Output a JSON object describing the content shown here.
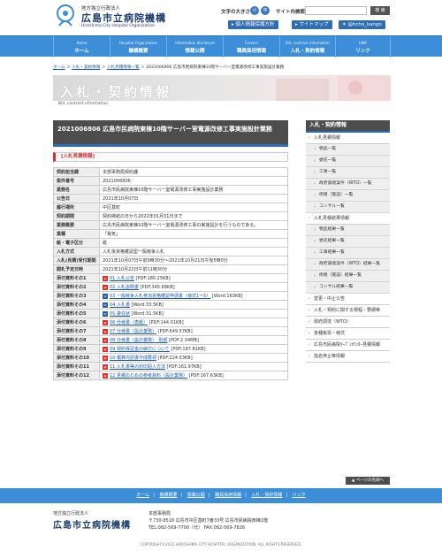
{
  "header": {
    "org_small": "地方独立行政法人",
    "logo_main": "広島市立病院機構",
    "logo_en": "Hiroshima City Hospital Organization",
    "font_size_label": "文字の大きさ",
    "font_small": "小",
    "font_medium": "中",
    "font_large": "大",
    "search_label": "サイト内検索",
    "search_placeholder": "",
    "search_button": "検 索",
    "btn_privacy": "個人情報保護方針",
    "btn_sitemap": "サイトマップ",
    "btn_twitter": "@hcho_kango"
  },
  "gnav": [
    {
      "en": "Home",
      "ja": "ホーム"
    },
    {
      "en": "Hospital Organization",
      "ja": "機構概要"
    },
    {
      "en": "Information disclosure",
      "ja": "情報公開"
    },
    {
      "en": "Careers",
      "ja": "職員採用情報"
    },
    {
      "en": "Bid, contract information",
      "ja": "入札・契約情報"
    },
    {
      "en": "LINK",
      "ja": "リンク"
    }
  ],
  "breadcrumb": {
    "items": [
      "ホーム",
      "入札・契約情報",
      "入札見積情報一覧"
    ],
    "current": "2021006806 広島市民病院東棟10階サーバー室電源改修工事実施設計業務",
    "sep": "＞"
  },
  "banner": {
    "title": "入札・契約情報",
    "subtitle": "Bid, contract information"
  },
  "main": {
    "page_title": "2021006806 広島市民病院東棟10階サーバー室電源改修工事実施設計業務",
    "section_title": "[入札見積情報]",
    "rows": [
      {
        "label": "契約担当課",
        "value": "本部事務局契約課"
      },
      {
        "label": "案件番号",
        "value": "2021006806"
      },
      {
        "label": "業務名",
        "value": "広島市民病院東棟10階サーバー室電源改修工事実施設計業務"
      },
      {
        "label": "公告日",
        "value": "2021年10月07日"
      },
      {
        "label": "履行場所",
        "value": "中区基町"
      },
      {
        "label": "契約期間",
        "value": "契約締結の日から2022年01月31日まで"
      },
      {
        "label": "業務概要",
        "value": "広島市民病院東棟10階サーバー室電源改修工事の実施設計を行うものである。"
      },
      {
        "label": "業種",
        "value": "「電気」"
      },
      {
        "label": "紙・電子区分",
        "value": "紙"
      },
      {
        "label": "入札方式",
        "value": "入札後資格確認型一般競争入札"
      },
      {
        "label": "入札(見積)受付期間",
        "value": "2021年10月07日午前9時30分～2021年10月21日午後5時0分"
      },
      {
        "label": "開札予定日時",
        "value": "2021年10月22日午前11時30分"
      }
    ],
    "files": [
      {
        "label": "添付資料その1",
        "icon": "pdf",
        "name": "01 入札公告",
        "meta": "[PDF:180.25KB]"
      },
      {
        "label": "添付資料その2",
        "icon": "pdf",
        "name": "02 入札説明書",
        "meta": "[PDF:345.68KB]"
      },
      {
        "label": "添付資料その3",
        "icon": "word",
        "name": "03 一般競争入札参加資格確認申請書（様式1～5）",
        "meta": "[Word:163KB]"
      },
      {
        "label": "添付資料その4",
        "icon": "word",
        "name": "04 入札書",
        "meta": "[Word:33.5KB]"
      },
      {
        "label": "添付資料その5",
        "icon": "word",
        "name": "05 委任状",
        "meta": "[Word:31.5KB]"
      },
      {
        "label": "添付資料その6",
        "icon": "pdf",
        "name": "06 仕様書（表紙）",
        "meta": "[PDF:144.01KB]"
      },
      {
        "label": "添付資料その7",
        "icon": "pdf",
        "name": "07 仕様書（設計業務）",
        "meta": "[PDF:649.57KB]"
      },
      {
        "label": "添付資料その8",
        "icon": "pdf",
        "name": "08 仕様書（設計業務）　別紙",
        "meta": "[PDF:2.34MB]"
      },
      {
        "label": "添付資料その9",
        "icon": "pdf",
        "name": "09 契約保証金の納付について",
        "meta": "[PDF:187.81KB]"
      },
      {
        "label": "添付資料その10",
        "icon": "pdf",
        "name": "10 積算内訳書作成要領",
        "meta": "[PDF:224.53KB]"
      },
      {
        "label": "添付資料その11",
        "icon": "pdf",
        "name": "11 入札書等の封印貼入方法",
        "meta": "[PDF:161.97KB]"
      },
      {
        "label": "添付資料その12",
        "icon": "pdf",
        "name": "12 見積のための参考資料（設計業務）",
        "meta": "[PDF:167.63KB]"
      }
    ]
  },
  "sidebar": {
    "title": "入札・契約情報",
    "items": [
      {
        "type": "cat",
        "label": "入札見積情報"
      },
      {
        "type": "sub",
        "label": "物品一覧"
      },
      {
        "type": "sub",
        "label": "委託一覧"
      },
      {
        "type": "sub",
        "label": "工事一覧"
      },
      {
        "type": "sub",
        "label": "政府調達案件（WTO）一覧"
      },
      {
        "type": "sub",
        "label": "修繕（施設）一覧"
      },
      {
        "type": "sub",
        "label": "コンサル一覧"
      },
      {
        "type": "cat",
        "label": "入札見積結果情報"
      },
      {
        "type": "sub",
        "label": "物品結果一覧"
      },
      {
        "type": "sub",
        "label": "委託結果一覧"
      },
      {
        "type": "sub",
        "label": "工事結果一覧"
      },
      {
        "type": "sub",
        "label": "政府調達案件（WTO）結果一覧"
      },
      {
        "type": "sub",
        "label": "修繕（施設）結果一覧"
      },
      {
        "type": "sub",
        "label": "コンサル結果一覧"
      },
      {
        "type": "cat",
        "label": "変更・中止公告"
      },
      {
        "type": "cat",
        "label": "入札・契約に関する規程・要綱等"
      },
      {
        "type": "cat",
        "label": "政府調達（WTO）"
      },
      {
        "type": "cat",
        "label": "各種帳票・様式"
      },
      {
        "type": "cat",
        "label": "広島市民病院ｵｰﾌﾟﾝｶｳﾝﾀｰ見積情報"
      },
      {
        "type": "cat",
        "label": "指名停止等情報"
      }
    ]
  },
  "pagetop": "▲ ページの先頭へ",
  "footer": {
    "nav": [
      "ホーム",
      "機構概要",
      "情報公開",
      "職員採用情報",
      "入札・契約情報",
      "リンク"
    ],
    "org_small": "地方独立行政法人",
    "logo_main": "広島市立病院機構",
    "dept": "本部事務局",
    "address": "〒730-8518 広島市中区基町7番33号 広島市民病院西棟2階",
    "tel": "TEL:082-569-7700（代）  FAX:082-569-7826",
    "copyright": "COPYRIGHT©2021 HIROSHIMA CITY HOSPITAL ORGANIZATION. ALL RIGHTS RESERVED."
  },
  "colors": {
    "nav_blue": "#3c8ed8",
    "accent_red": "#cc3333",
    "dark_header": "#4d4d4d"
  }
}
